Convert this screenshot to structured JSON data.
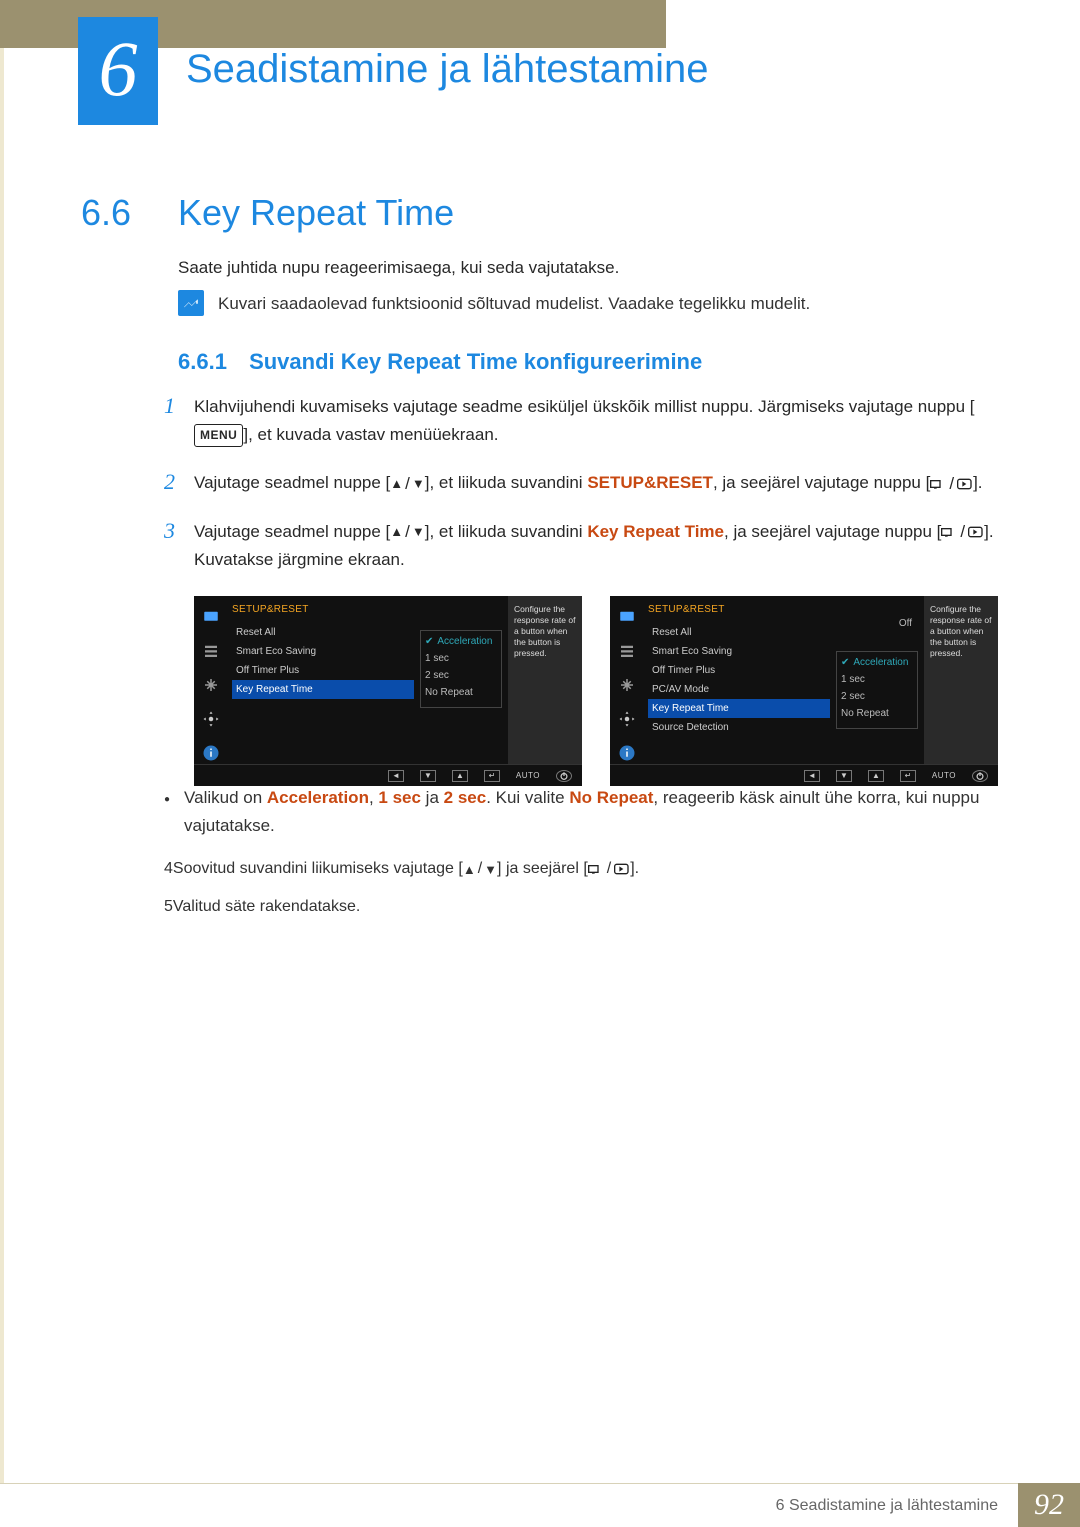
{
  "chapter_number": "6",
  "chapter_title": "Seadistamine ja lähtestamine",
  "section": {
    "num": "6.6",
    "title": "Key Repeat Time"
  },
  "intro": "Saate juhtida nupu reageerimisaega, kui seda vajutatakse.",
  "note": "Kuvari saadaolevad funktsioonid sõltuvad mudelist. Vaadake tegelikku mudelit.",
  "subsection": {
    "num": "6.6.1",
    "title": "Suvandi Key Repeat Time konfigureerimine"
  },
  "steps": {
    "s1": {
      "p1": "Klahvijuhendi kuvamiseks vajutage seadme esiküljel ükskõik millist nuppu. Järgmiseks vajutage nuppu [",
      "p2": "], et kuvada vastav menüüekraan.",
      "menu": "MENU"
    },
    "s2": {
      "p1": "Vajutage seadmel nuppe [",
      "p2": "], et liikuda suvandini ",
      "kw": "SETUP&RESET",
      "p3": ", ja seejärel vajutage nuppu [",
      "p4": "]."
    },
    "s3": {
      "p1": "Vajutage seadmel nuppe [",
      "p2": "], et liikuda suvandini ",
      "kw": "Key Repeat Time",
      "p3": ", ja seejärel vajutage nuppu [",
      "p4": "].",
      "sub": "Kuvatakse järgmine ekraan."
    },
    "bullet": {
      "p1": "Valikud on ",
      "w1": "Acceleration",
      "c1": ", ",
      "w2": "1 sec",
      "c2": " ja ",
      "w3": "2 sec",
      "c3": ". Kui valite ",
      "w4": "No Repeat",
      "c4": ", reageerib käsk ainult ühe korra, kui nuppu vajutatakse."
    },
    "s4": {
      "p1": "Soovitud suvandini liikumiseks vajutage [",
      "p2": "] ja seejärel [",
      "p3": "]."
    },
    "s5": "Valitud säte rakendatakse."
  },
  "osd": {
    "head": "SETUP&RESET",
    "help": "Configure the response rate of a button when the button is pressed.",
    "auto": "AUTO",
    "left": {
      "items": [
        "Reset All",
        "Smart Eco Saving",
        "Off Timer Plus",
        "Key Repeat Time"
      ],
      "hl": 3,
      "opts": [
        "Acceleration",
        "1 sec",
        "2 sec",
        "No Repeat"
      ]
    },
    "right": {
      "items": [
        "Reset All",
        "Smart Eco Saving",
        "Off Timer Plus",
        "PC/AV Mode",
        "Key Repeat Time",
        "Source Detection"
      ],
      "hl": 4,
      "off_label": "Off",
      "opts": [
        "Acceleration",
        "1 sec",
        "2 sec",
        "No Repeat"
      ]
    }
  },
  "footer": {
    "label": "6 Seadistamine ja lähtestamine",
    "page": "92"
  },
  "numbers": {
    "n1": "1",
    "n2": "2",
    "n3": "3",
    "n4": "4",
    "n5": "5"
  }
}
